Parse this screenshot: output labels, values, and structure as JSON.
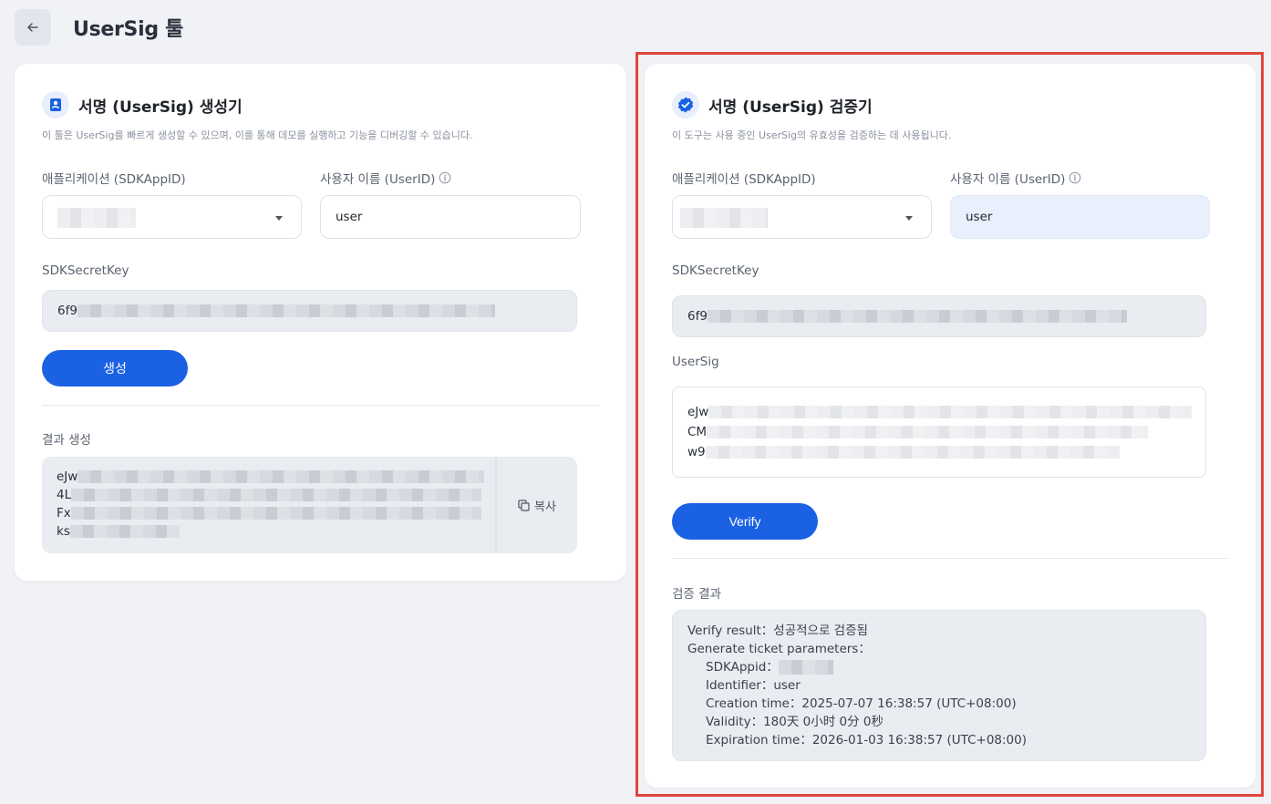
{
  "page": {
    "title": "UserSig 툴"
  },
  "generator": {
    "title": "서명 (UserSig) 생성기",
    "description": "이 툴은 UserSig를 빠르게 생성할 수 있으며, 이를 통해 데모를 실행하고 기능을 디버깅할 수 있습니다.",
    "app_label": "애플리케이션 (SDKAppID)",
    "user_label": "사용자 이름 (UserID)",
    "user_value": "user",
    "secret_label": "SDKSecretKey",
    "secret_prefix": "6f9",
    "generate_button": "생성",
    "result_label": "결과 생성",
    "result_prefixes": [
      "eJw",
      "4L",
      "Fx",
      "ks"
    ],
    "copy_label": "복사"
  },
  "verifier": {
    "title": "서명 (UserSig) 검증기",
    "description": "이 도구는 사용 중인 UserSig의 유효성을 검증하는 데 사용됩니다.",
    "app_label": "애플리케이션 (SDKAppID)",
    "user_label": "사용자 이름 (UserID)",
    "user_value": "user",
    "secret_label": "SDKSecretKey",
    "secret_prefix": "6f9",
    "usersig_label": "UserSig",
    "usersig_prefixes": [
      "eJw",
      "CM",
      "w9"
    ],
    "verify_button": "Verify",
    "result_label": "검증 결과",
    "result_lines": [
      "Verify result：성공적으로 검증됨",
      "Generate ticket parameters：",
      "SDKAppid：",
      "Identifier：user",
      "Creation time：2025-07-07 16:38:57 (UTC+08:00)",
      "Validity：180天 0小时 0分 0秒",
      "Expiration time：2026-01-03 16:38:57 (UTC+08:00)"
    ]
  },
  "colors": {
    "primary": "#1a62e3",
    "highlight_border": "#e0463c",
    "background": "#f0f2f6"
  },
  "icons": [
    "arrow-left-icon",
    "user-badge-icon",
    "verified-badge-icon",
    "info-icon",
    "chevron-down-icon",
    "copy-icon"
  ]
}
